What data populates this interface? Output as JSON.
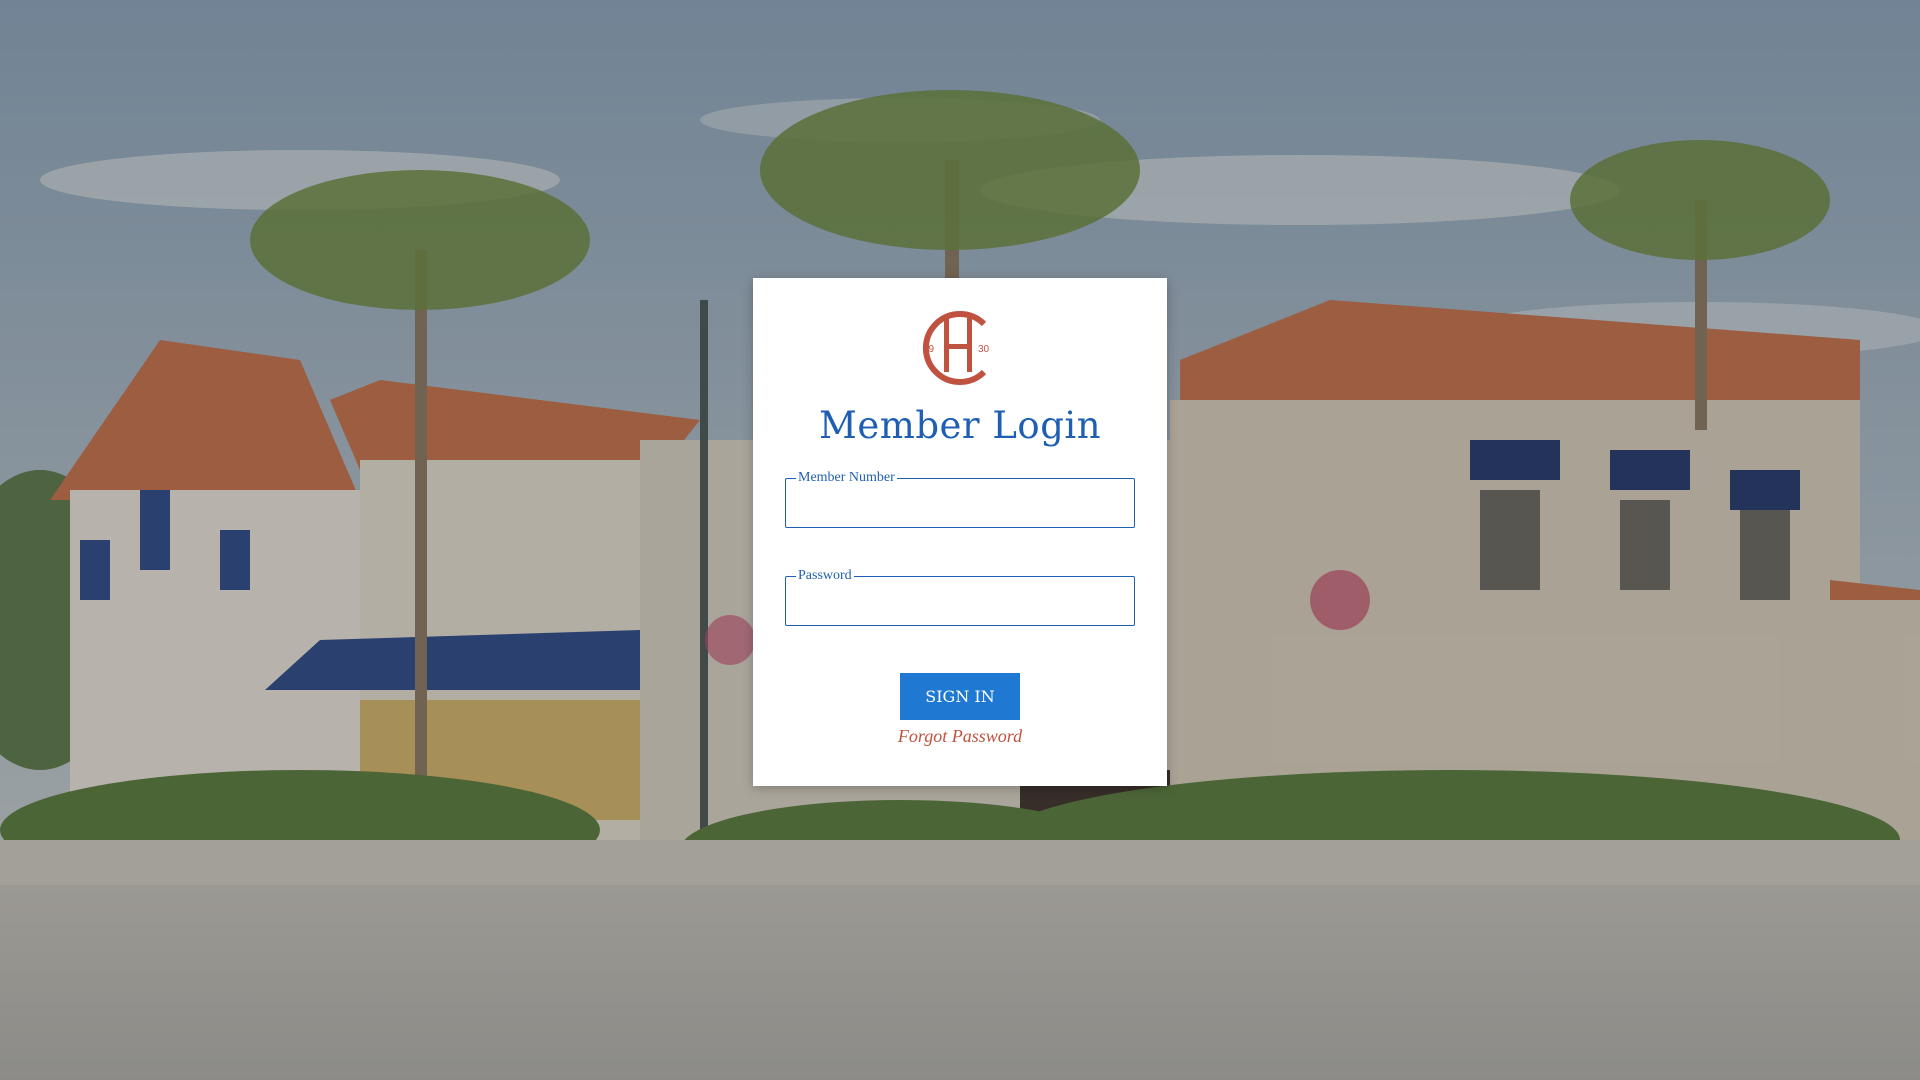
{
  "login": {
    "title": "Member Login",
    "logo": {
      "letters": "CH",
      "year_left": "19",
      "year_right": "30",
      "color": "#c0533f"
    },
    "member_number": {
      "label": "Member Number",
      "value": ""
    },
    "password": {
      "label": "Password",
      "value": ""
    },
    "sign_in_label": "SIGN IN",
    "forgot_password_label": "Forgot Password",
    "colors": {
      "accent": "#1f5fb3",
      "button": "#1f78d1",
      "link": "#c0533f"
    }
  },
  "background": {
    "description_icon": "club-building-watercolor-illustration"
  }
}
